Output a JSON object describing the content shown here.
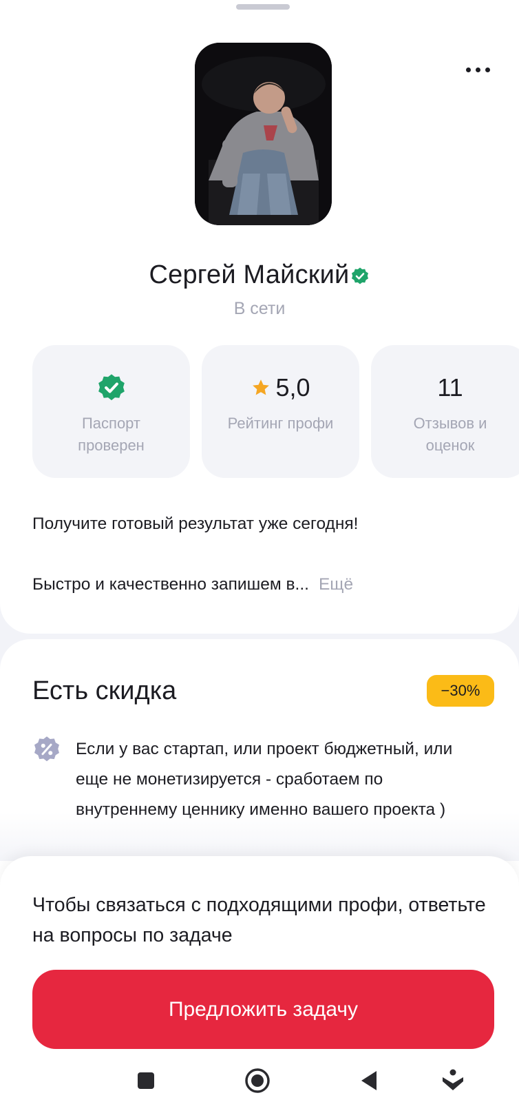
{
  "profile": {
    "name": "Сергей Майский",
    "status": "В сети"
  },
  "stats": [
    {
      "value": "",
      "label": "Паспорт проверен",
      "icon": "verified-check-icon"
    },
    {
      "value": "5,0",
      "label": "Рейтинг профи",
      "icon": "star-icon"
    },
    {
      "value": "11",
      "label": "Отзывов и оценок",
      "icon": ""
    }
  ],
  "about": {
    "line1": "Получите готовый результат уже сегодня!",
    "line2": "Быстро и качественно запишем в...",
    "more_label": "Ещё"
  },
  "discount": {
    "title": "Есть скидка",
    "badge": "−30%",
    "text": "Если у вас стартап, или проект бюджетный, или еще не монетизируется - сработаем по внутреннему ценнику именно вашего проекта )"
  },
  "cta": {
    "hint": "Чтобы связаться с подходящими профи, ответьте на вопросы по задаче",
    "button_label": "Предложить задачу"
  },
  "colors": {
    "accent_red": "#e6273f",
    "badge_yellow": "#fbbb17",
    "verified_green": "#1fa46a",
    "star_orange": "#f5a623",
    "muted_text": "#a4a6b4"
  },
  "nav": [
    "nav-recents-icon",
    "nav-home-icon",
    "nav-back-icon",
    "nav-assistant-icon"
  ]
}
